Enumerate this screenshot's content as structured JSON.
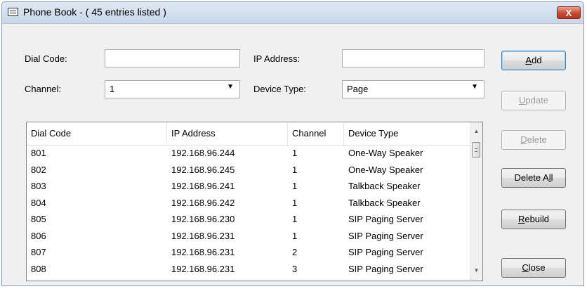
{
  "window": {
    "title": "Phone Book - ( 45 entries listed )",
    "close_label": "X"
  },
  "form": {
    "dial_code_label": "Dial Code:",
    "dial_code_value": "",
    "ip_address_label": "IP Address:",
    "ip_address_value": "",
    "channel_label": "Channel:",
    "channel_value": "1",
    "device_type_label": "Device Type:",
    "device_type_value": "Page",
    "dropdown_icon": "chevron-down-icon"
  },
  "buttons": {
    "add": {
      "pre": "",
      "accel": "A",
      "post": "dd",
      "enabled": true
    },
    "update": {
      "pre": "",
      "accel": "U",
      "post": "pdate",
      "enabled": false
    },
    "delete": {
      "pre": "",
      "accel": "D",
      "post": "elete",
      "enabled": false
    },
    "delete_all": {
      "pre": "Delete A",
      "accel": "l",
      "post": "l",
      "enabled": true
    },
    "rebuild": {
      "pre": "",
      "accel": "R",
      "post": "ebuild",
      "enabled": true
    },
    "close": {
      "pre": "",
      "accel": "C",
      "post": "lose",
      "enabled": true
    }
  },
  "list": {
    "columns": [
      "Dial Code",
      "IP Address",
      "Channel",
      "Device Type"
    ],
    "rows": [
      [
        "801",
        "192.168.96.244",
        "1",
        "One-Way Speaker"
      ],
      [
        "802",
        "192.168.96.245",
        "1",
        "One-Way Speaker"
      ],
      [
        "803",
        "192.168.96.241",
        "1",
        "Talkback Speaker"
      ],
      [
        "804",
        "192.168.96.242",
        "1",
        "Talkback Speaker"
      ],
      [
        "805",
        "192.168.96.230",
        "1",
        "SIP Paging Server"
      ],
      [
        "806",
        "192.168.96.231",
        "1",
        "SIP Paging Server"
      ],
      [
        "807",
        "192.168.96.231",
        "2",
        "SIP Paging Server"
      ],
      [
        "808",
        "192.168.96.231",
        "3",
        "SIP Paging Server"
      ]
    ]
  },
  "colors": {
    "window_bg": "#f0f0f0",
    "titlebar": "#c9d7e8",
    "close_button": "#c94a32",
    "default_button_border": "#3c7fb1",
    "disabled_text": "#9a9a9a"
  }
}
